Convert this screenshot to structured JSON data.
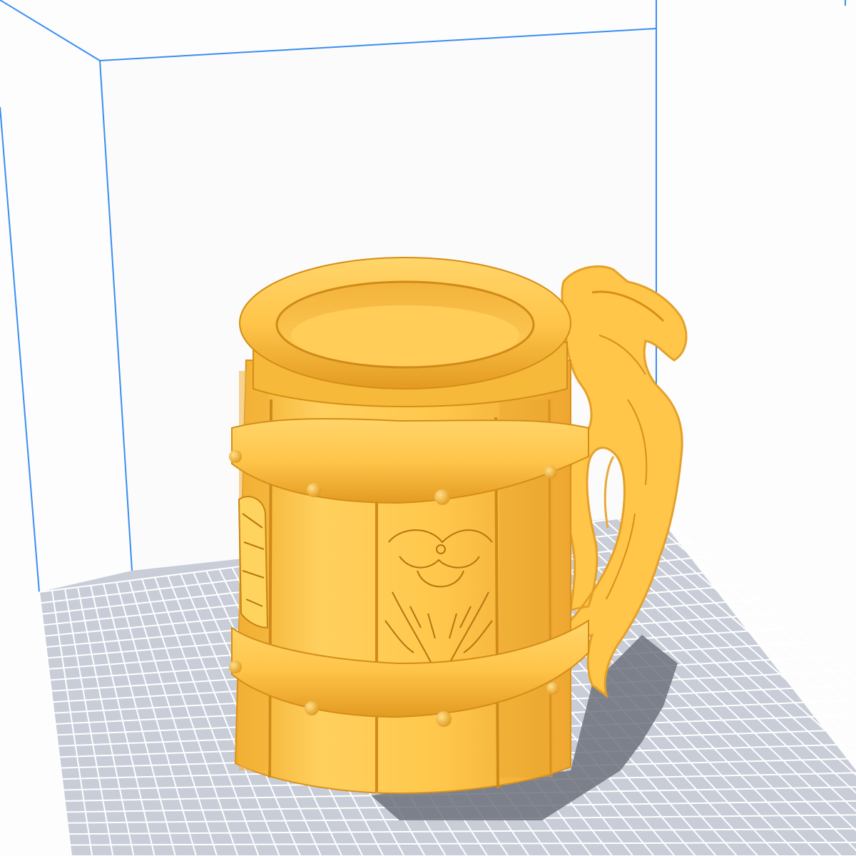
{
  "app": {
    "view": "slicer-3d-preview"
  },
  "scene": {
    "background_color": "#fdfdfd",
    "build_volume_edge_color": "#3a8ef0",
    "build_plate_color": "#c8cdd8",
    "build_plate_grid_color": "#ffffff",
    "model_color": "#ffc64a",
    "model_shade_color": "#e09a1c",
    "shadow_color": "#6e727c"
  },
  "model": {
    "name": "viking-tankard",
    "parts": [
      "rim",
      "barrel-staves",
      "upper-hoop",
      "lower-hoop",
      "rivets",
      "relief-emblems",
      "dragon-handle"
    ],
    "icon": "tankard-model"
  }
}
